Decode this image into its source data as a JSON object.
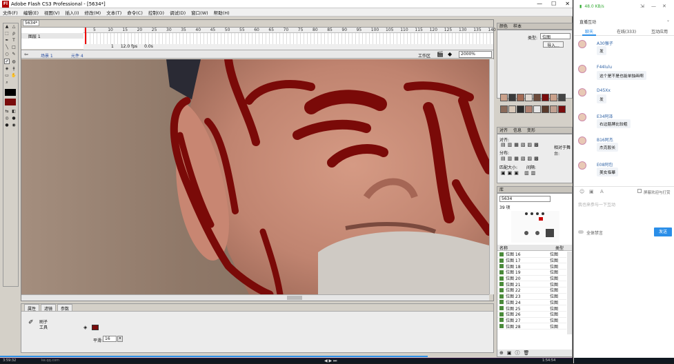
{
  "app": {
    "title": "Adobe Flash CS3 Professional - [5634*]",
    "badge": "Fl",
    "menu": [
      "文件(F)",
      "编辑(E)",
      "视图(V)",
      "插入(I)",
      "修改(M)",
      "文本(T)",
      "命令(C)",
      "控制(O)",
      "调试(D)",
      "窗口(W)",
      "帮助(H)"
    ]
  },
  "document": {
    "tab": "5634*",
    "layer_name": "图层 1",
    "ruler_ticks": [
      "5",
      "10",
      "15",
      "20",
      "25",
      "30",
      "35",
      "40",
      "45",
      "50",
      "55",
      "60",
      "65",
      "70",
      "75",
      "80",
      "85",
      "90",
      "95",
      "100",
      "105",
      "110",
      "115",
      "120",
      "125",
      "130",
      "135",
      "140"
    ],
    "status_frame": "1",
    "status_fps": "12.0 fps",
    "status_time": "0.0s",
    "scene_label": "场景 1",
    "symbol_label": "元件 4",
    "workspace_label": "工作区",
    "zoom": "2000%"
  },
  "properties": {
    "tabs": [
      "属性",
      "滤镜",
      "参数"
    ],
    "tool_name_line1": "刷子",
    "tool_name_line2": "工具",
    "smooth_label": "平滑:",
    "smooth_value": "16",
    "brush_color": "#7a0c0c"
  },
  "panels": {
    "color_tabs": [
      "颜色",
      "样本"
    ],
    "type_label": "类型:",
    "type_value": "位图",
    "import_button": "导入...",
    "align_tabs": [
      "对齐",
      "信息",
      "变形"
    ],
    "align_label": "对齐:",
    "distribute_label": "分布:",
    "match_label": "匹配大小:",
    "spacing_label": "间隔:",
    "to_stage_label": "相对于舞台:",
    "library_title": "库",
    "library_doc": "5634",
    "library_count": "39 项",
    "col_name": "名称",
    "col_type": "类型",
    "library_items": [
      {
        "name": "位图 16",
        "type": "位图"
      },
      {
        "name": "位图 17",
        "type": "位图"
      },
      {
        "name": "位图 18",
        "type": "位图"
      },
      {
        "name": "位图 19",
        "type": "位图"
      },
      {
        "name": "位图 20",
        "type": "位图"
      },
      {
        "name": "位图 21",
        "type": "位图"
      },
      {
        "name": "位图 22",
        "type": "位图"
      },
      {
        "name": "位图 23",
        "type": "位图"
      },
      {
        "name": "位图 24",
        "type": "位图"
      },
      {
        "name": "位图 25",
        "type": "位图"
      },
      {
        "name": "位图 26",
        "type": "位图"
      },
      {
        "name": "位图 27",
        "type": "位图"
      },
      {
        "name": "位图 28",
        "type": "位图"
      }
    ]
  },
  "taskbar": {
    "time_left": "3:59:32",
    "url": "ke.qq.com",
    "time_right": "1:54:54"
  },
  "sidebar": {
    "speed": "48.0 KB/s",
    "title": "直播互动",
    "tabs": [
      "聊天",
      "在线(333)",
      "互动应用"
    ],
    "messages": [
      {
        "name": "A30猴子",
        "text": "发"
      },
      {
        "name": "F44lulu",
        "text": "这个是不是也能单独画啊"
      },
      {
        "name": "D45Xx",
        "text": "发"
      },
      {
        "name": "E34阿泽",
        "text": "右边胳膊比较粗"
      },
      {
        "name": "B16阿杰",
        "text": "杰克股长"
      },
      {
        "name": "E08阿包",
        "text": "美女临摹"
      }
    ],
    "input_placeholder": "我也来参与一下互动",
    "check_label": "屏蔽欢迎与打赏",
    "mute_label": "全体禁言",
    "send_button": "发送",
    "accent": "#2a8ee8"
  }
}
